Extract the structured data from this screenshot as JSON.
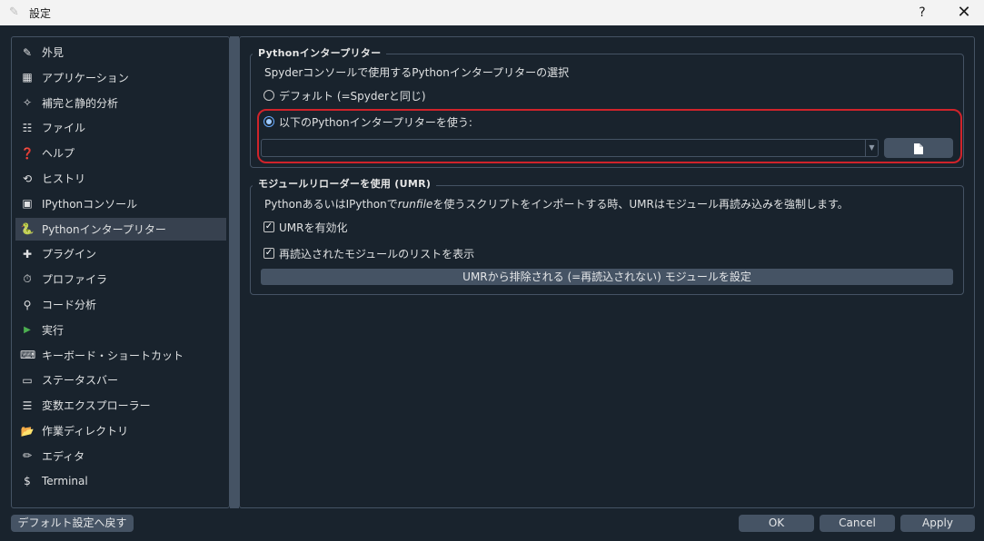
{
  "window": {
    "title": "設定",
    "help_label": "?",
    "close_label": "✕",
    "app_icon": "✎"
  },
  "sidebar": {
    "items": [
      {
        "label": "外見",
        "icon": "brush-icon",
        "glyph": "✎"
      },
      {
        "label": "アプリケーション",
        "icon": "application-icon",
        "glyph": "▦"
      },
      {
        "label": "補完と静的分析",
        "icon": "completion-icon",
        "glyph": "✧"
      },
      {
        "label": "ファイル",
        "icon": "file-tree-icon",
        "glyph": "☷"
      },
      {
        "label": "ヘルプ",
        "icon": "help-icon",
        "glyph": "❓"
      },
      {
        "label": "ヒストリ",
        "icon": "history-icon",
        "glyph": "⟲"
      },
      {
        "label": "IPythonコンソール",
        "icon": "console-icon",
        "glyph": "▣"
      },
      {
        "label": "Pythonインタープリター",
        "icon": "python-icon",
        "glyph": "🐍"
      },
      {
        "label": "プラグイン",
        "icon": "puzzle-icon",
        "glyph": "✚"
      },
      {
        "label": "プロファイラ",
        "icon": "timer-icon",
        "glyph": "⏱"
      },
      {
        "label": "コード分析",
        "icon": "code-analysis-icon",
        "glyph": "⚲"
      },
      {
        "label": "実行",
        "icon": "run-icon",
        "glyph": "▶"
      },
      {
        "label": "キーボード・ショートカット",
        "icon": "keyboard-icon",
        "glyph": "⌨"
      },
      {
        "label": "ステータスバー",
        "icon": "statusbar-icon",
        "glyph": "▭"
      },
      {
        "label": "変数エクスプローラー",
        "icon": "table-icon",
        "glyph": "☰"
      },
      {
        "label": "作業ディレクトリ",
        "icon": "folder-icon",
        "glyph": "📂"
      },
      {
        "label": "エディタ",
        "icon": "pencil-icon",
        "glyph": "✏"
      },
      {
        "label": "Terminal",
        "icon": "dollar-icon",
        "glyph": "$"
      }
    ],
    "active_index": 7
  },
  "interpreter": {
    "group_title": "Pythonインタープリター",
    "description": "Spyderコンソールで使用するPythonインタープリターの選択",
    "default_option": "デフォルト (=Spyderと同じ)",
    "custom_option": "以下のPythonインタープリターを使う:",
    "selected": "custom",
    "path_value": "",
    "browse_icon": "file-icon"
  },
  "umr": {
    "group_title": "モジュールリローダーを使用 (UMR)",
    "description_before": "PythonあるいはIPythonで",
    "description_em": "runfile",
    "description_after": "を使うスクリプトをインポートする時、UMRはモジュール再読み込みを強制します。",
    "enable_label": "UMRを有効化",
    "enable_checked": true,
    "show_list_label": "再読込されたモジュールのリストを表示",
    "show_list_checked": true,
    "exclude_button": "UMRから排除される (=再読込されない) モジュールを設定"
  },
  "footer": {
    "reset_button": "デフォルト設定へ戻す",
    "ok_button": "OK",
    "cancel_button": "Cancel",
    "apply_button": "Apply"
  }
}
